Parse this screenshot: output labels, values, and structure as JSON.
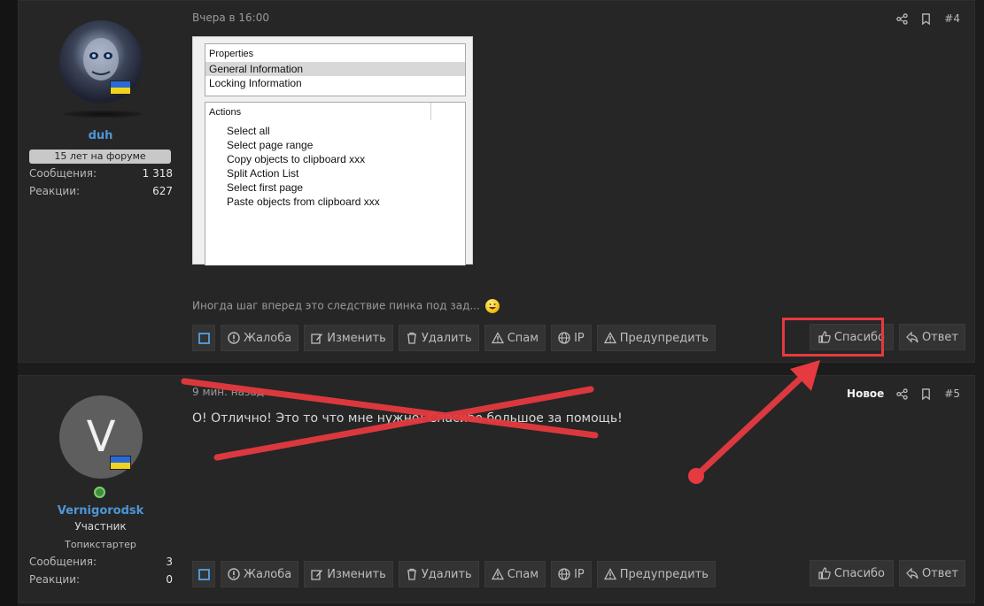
{
  "colors": {
    "accent": "#4e96d6",
    "red_annotation": "#e53a40",
    "background": "#262626"
  },
  "post4": {
    "date": "Вчера в 16:00",
    "number": "#4",
    "user": {
      "name": "duh",
      "years_badge": "15 лет на форуме",
      "stats": [
        {
          "label": "Сообщения:",
          "value": "1 318"
        },
        {
          "label": "Реакции:",
          "value": "627"
        }
      ]
    },
    "image": {
      "properties": {
        "header": "Properties",
        "rows": [
          "General Information",
          "Locking Information"
        ]
      },
      "actions": {
        "header": "Actions",
        "items": [
          "Select all",
          "Select page range",
          "Copy objects to clipboard xxx",
          "Split Action List",
          "Select first page",
          "Paste objects from clipboard xxx"
        ]
      }
    },
    "signature": "Иногда шаг вперед это следствие пинка под зад..."
  },
  "post5": {
    "date": "9 мин. назад",
    "new_label": "Новое",
    "number": "#5",
    "user": {
      "initial": "V",
      "name": "Vernigorodsk",
      "role": "Участник",
      "subrole": "Топикстартер",
      "stats": [
        {
          "label": "Сообщения:",
          "value": "3"
        },
        {
          "label": "Реакции:",
          "value": "0"
        }
      ]
    },
    "text": "О! Отлично! Это то что мне нужно! Спасибо большое за помощь!"
  },
  "buttons": {
    "report": "Жалоба",
    "edit": "Изменить",
    "delete": "Удалить",
    "spam": "Спам",
    "ip": "IP",
    "warn": "Предупредить",
    "like": "Спасибо",
    "reply": "Ответ"
  }
}
